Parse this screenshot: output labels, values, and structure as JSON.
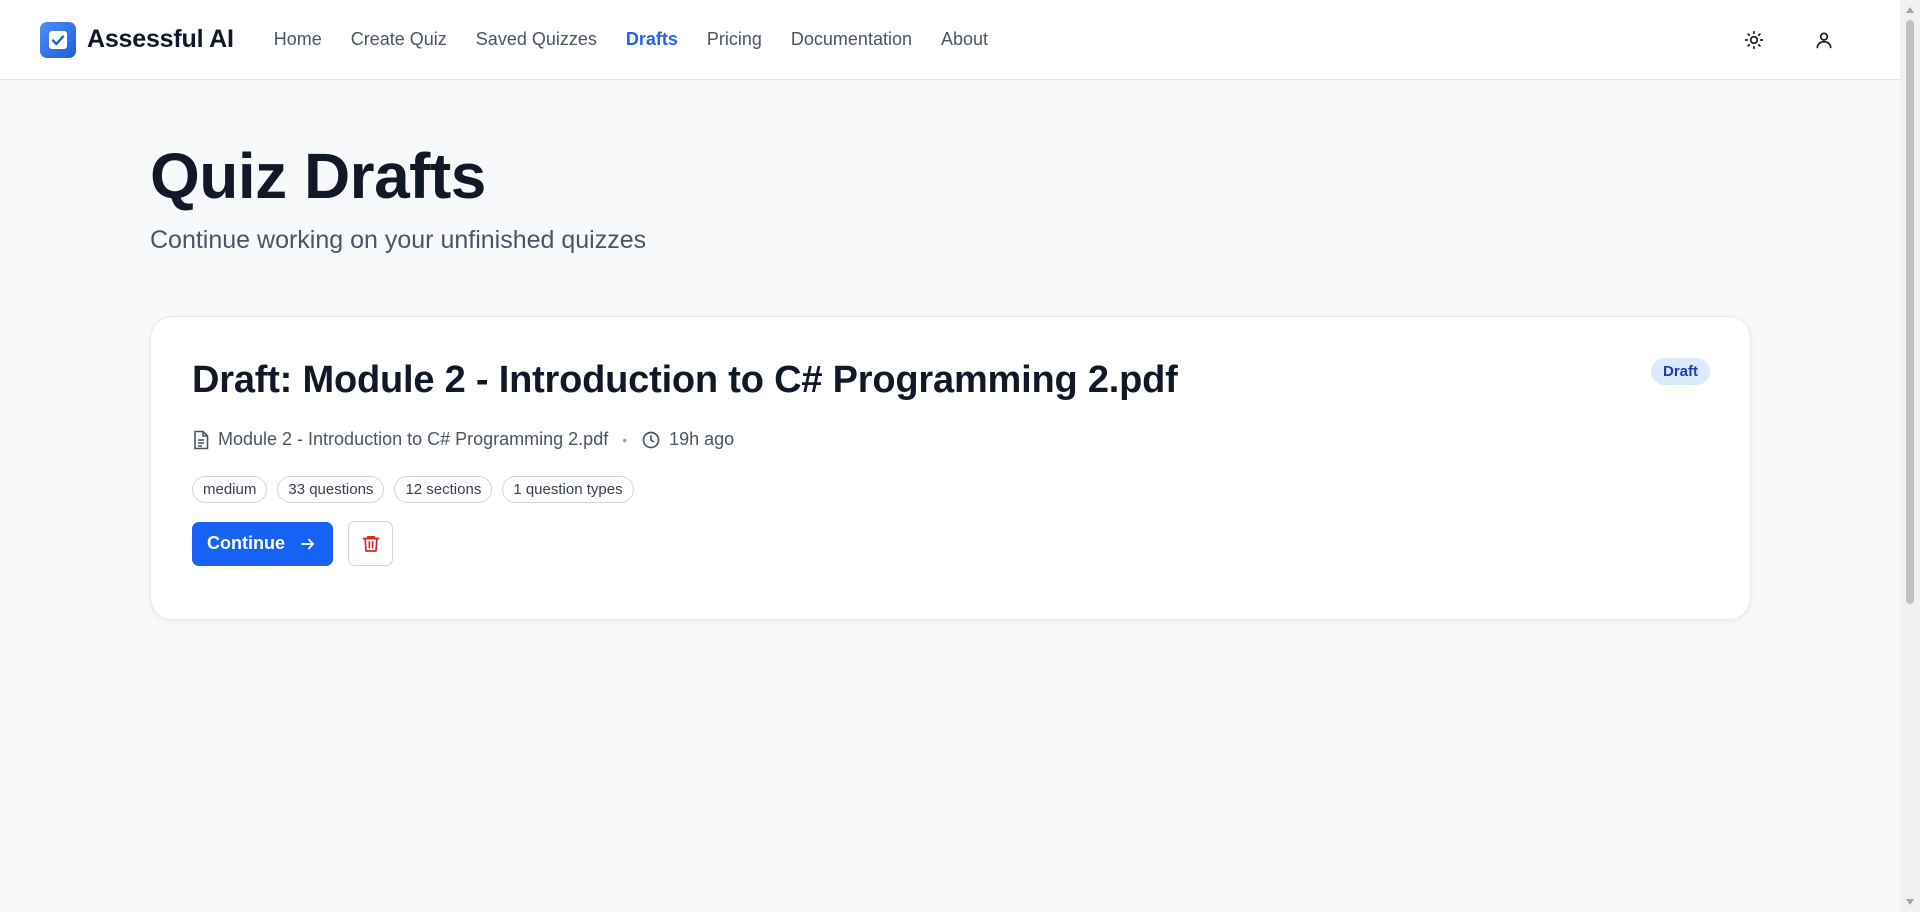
{
  "brand": {
    "name": "Assessful AI"
  },
  "nav": {
    "items": [
      {
        "label": "Home",
        "active": false
      },
      {
        "label": "Create Quiz",
        "active": false
      },
      {
        "label": "Saved Quizzes",
        "active": false
      },
      {
        "label": "Drafts",
        "active": true
      },
      {
        "label": "Pricing",
        "active": false
      },
      {
        "label": "Documentation",
        "active": false
      },
      {
        "label": "About",
        "active": false
      }
    ],
    "actions": {
      "theme_icon": "sun-icon",
      "profile_icon": "user-icon"
    }
  },
  "page": {
    "title": "Quiz Drafts",
    "subtitle": "Continue working on your unfinished quizzes"
  },
  "draft": {
    "title": "Draft: Module 2 - Introduction to C# Programming 2.pdf",
    "badge": "Draft",
    "filename": "Module 2 - Introduction to C# Programming 2.pdf",
    "separator": "•",
    "time": "19h ago",
    "tags": [
      "medium",
      "33 questions",
      "12 sections",
      "1 question types"
    ],
    "continue_label": "Continue"
  },
  "colors": {
    "accent": "#1662f5",
    "active_nav": "#2563eb",
    "badge_bg": "#dbeafe",
    "badge_text": "#1e40af",
    "danger": "#dc2626"
  }
}
